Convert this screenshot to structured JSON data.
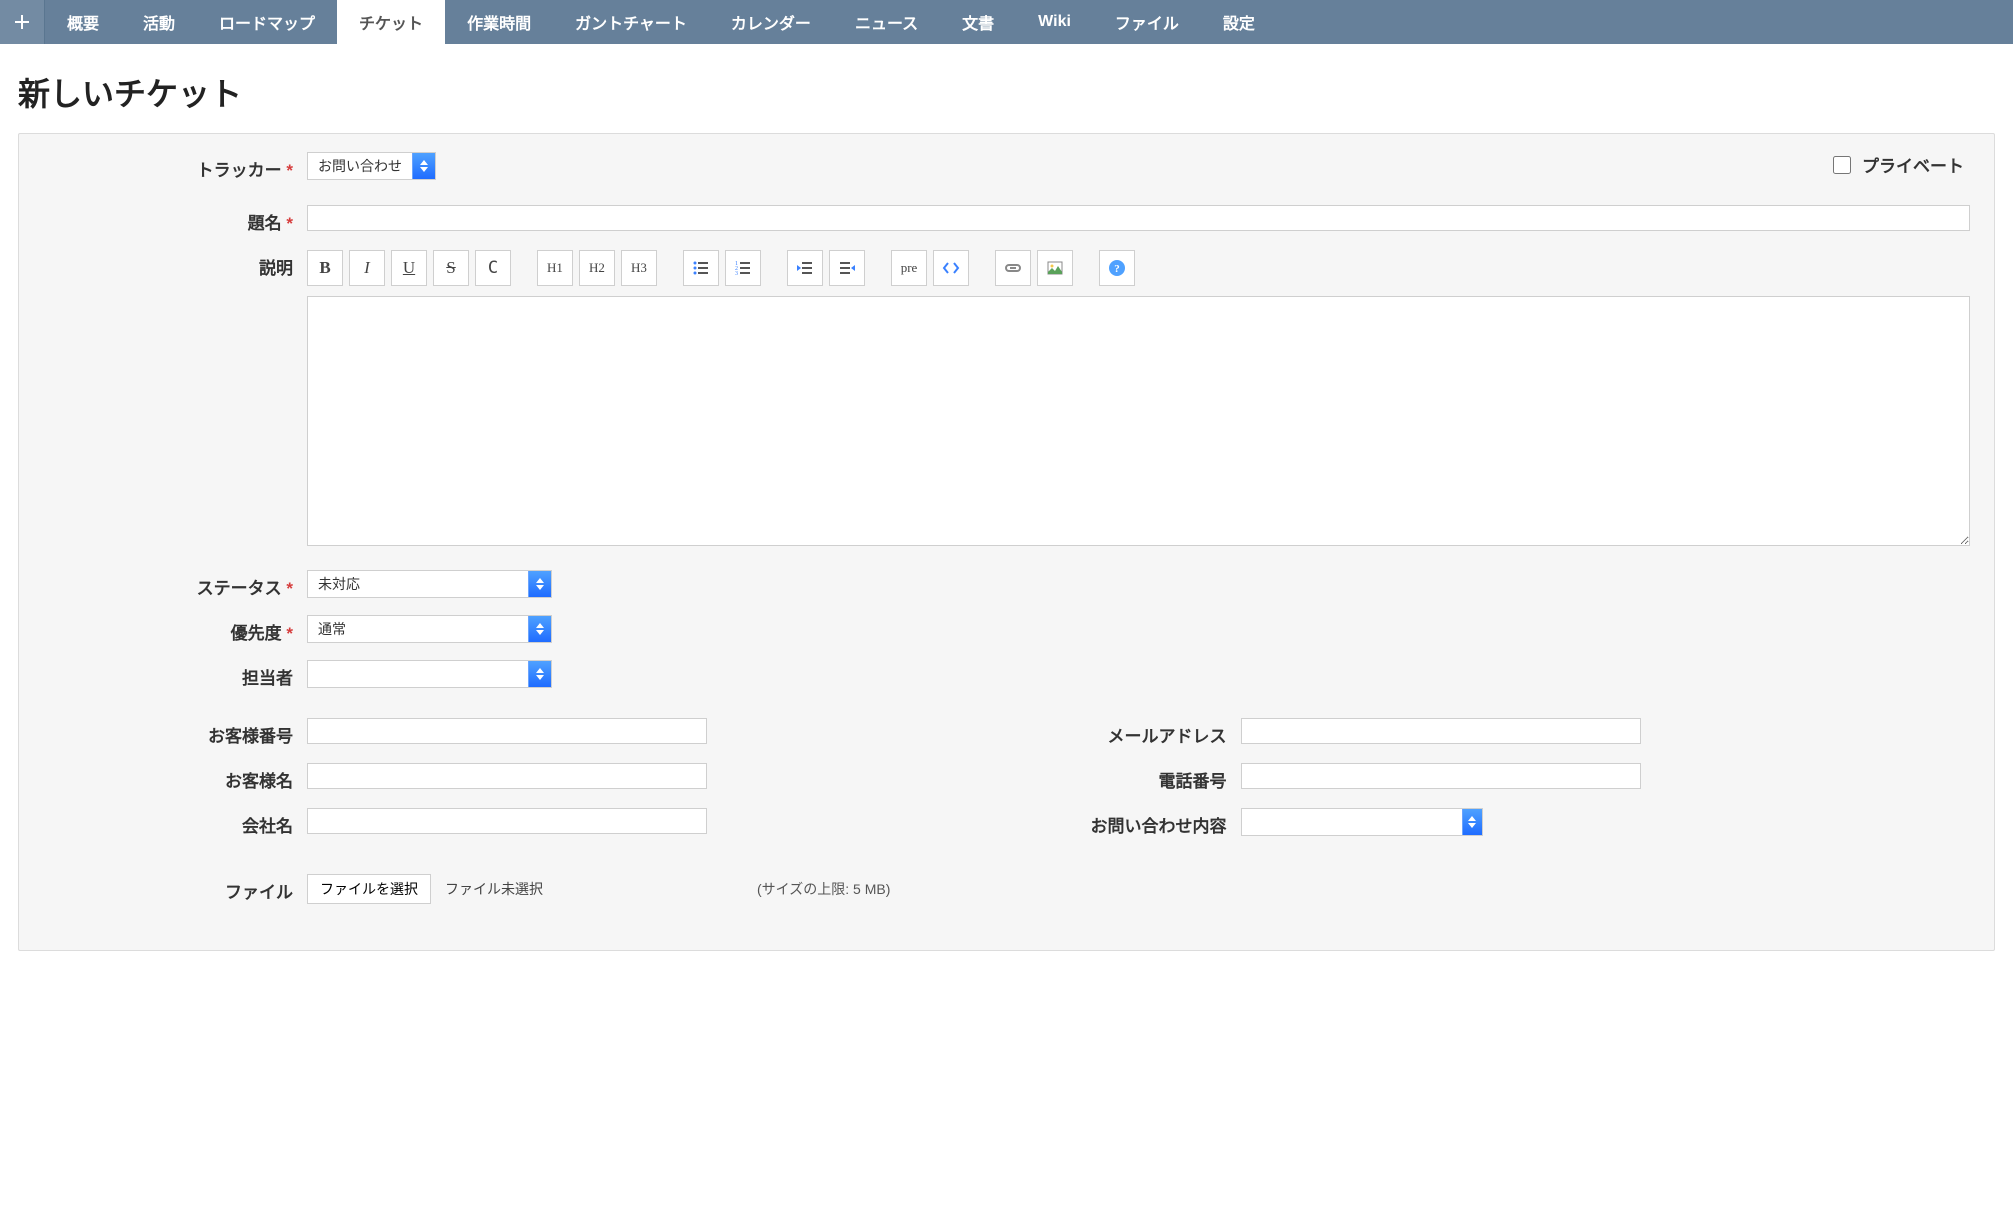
{
  "nav": {
    "plus_title": "新規",
    "items": [
      {
        "id": "overview",
        "label": "概要",
        "active": false
      },
      {
        "id": "activity",
        "label": "活動",
        "active": false
      },
      {
        "id": "roadmap",
        "label": "ロードマップ",
        "active": false
      },
      {
        "id": "issues",
        "label": "チケット",
        "active": true
      },
      {
        "id": "timelog",
        "label": "作業時間",
        "active": false
      },
      {
        "id": "gantt",
        "label": "ガントチャート",
        "active": false
      },
      {
        "id": "calendar",
        "label": "カレンダー",
        "active": false
      },
      {
        "id": "news",
        "label": "ニュース",
        "active": false
      },
      {
        "id": "documents",
        "label": "文書",
        "active": false
      },
      {
        "id": "wiki",
        "label": "Wiki",
        "active": false
      },
      {
        "id": "files",
        "label": "ファイル",
        "active": false
      },
      {
        "id": "settings",
        "label": "設定",
        "active": false
      }
    ]
  },
  "page": {
    "title": "新しいチケット"
  },
  "private": {
    "label": "プライベート",
    "checked": false
  },
  "fields": {
    "tracker": {
      "label": "トラッカー",
      "required": true,
      "value": "お問い合わせ"
    },
    "subject": {
      "label": "題名",
      "required": true,
      "value": ""
    },
    "description": {
      "label": "説明",
      "required": false,
      "value": ""
    },
    "status": {
      "label": "ステータス",
      "required": true,
      "value": "未対応"
    },
    "priority": {
      "label": "優先度",
      "required": true,
      "value": "通常"
    },
    "assignee": {
      "label": "担当者",
      "required": false,
      "value": ""
    },
    "customer_no": {
      "label": "お客様番号",
      "required": false,
      "value": ""
    },
    "customer_name": {
      "label": "お客様名",
      "required": false,
      "value": ""
    },
    "company": {
      "label": "会社名",
      "required": false,
      "value": ""
    },
    "email": {
      "label": "メールアドレス",
      "required": false,
      "value": ""
    },
    "phone": {
      "label": "電話番号",
      "required": false,
      "value": ""
    },
    "inquiry": {
      "label": "お問い合わせ内容",
      "required": false,
      "value": ""
    },
    "file": {
      "label": "ファイル",
      "choose_label": "ファイルを選択",
      "status": "ファイル未選択",
      "hint": "(サイズの上限: 5 MB)"
    }
  },
  "editor_buttons": [
    {
      "id": "bold",
      "text": "B",
      "style": "bold"
    },
    {
      "id": "italic",
      "text": "I",
      "style": "italic"
    },
    {
      "id": "underline",
      "text": "U",
      "style": "underline"
    },
    {
      "id": "strike",
      "text": "S",
      "style": "strike"
    },
    {
      "id": "code-style",
      "text": "C",
      "style": "code"
    },
    {
      "id": "sep1",
      "sep": true
    },
    {
      "id": "h1",
      "text": "H1",
      "small": true
    },
    {
      "id": "h2",
      "text": "H2",
      "small": true
    },
    {
      "id": "h3",
      "text": "H3",
      "small": true
    },
    {
      "id": "sep2",
      "sep": true
    },
    {
      "id": "ul",
      "icon": "list-ul"
    },
    {
      "id": "ol",
      "icon": "list-ol"
    },
    {
      "id": "sep3",
      "sep": true
    },
    {
      "id": "outdent",
      "icon": "outdent"
    },
    {
      "id": "indent",
      "icon": "indent"
    },
    {
      "id": "sep4",
      "sep": true
    },
    {
      "id": "pre",
      "text": "pre",
      "small": true
    },
    {
      "id": "codeblock",
      "icon": "code"
    },
    {
      "id": "sep5",
      "sep": true
    },
    {
      "id": "link",
      "icon": "link"
    },
    {
      "id": "image",
      "icon": "image"
    },
    {
      "id": "sep6",
      "sep": true
    },
    {
      "id": "help",
      "icon": "help"
    }
  ]
}
